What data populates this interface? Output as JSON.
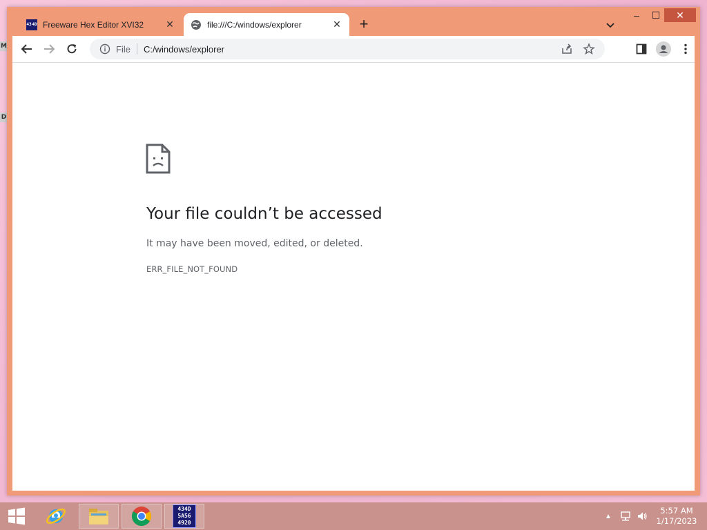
{
  "desktop": {
    "edge_glyphs": [
      "M",
      "D"
    ]
  },
  "browser": {
    "tabs": [
      {
        "title": "Freeware Hex Editor XVI32",
        "active": false,
        "favicon": "hex-editor-icon",
        "favicon_text": "434D"
      },
      {
        "title": "file:///C:/windows/explorer",
        "active": true,
        "favicon": "globe-icon"
      }
    ],
    "new_tab_glyph": "+",
    "window_controls": {
      "minimize": "–",
      "maximize": "☐",
      "close": "✕"
    },
    "toolbar": {
      "back": "back-arrow-icon",
      "forward": "forward-arrow-icon",
      "reload": "reload-icon",
      "omnibox_scheme": "File",
      "omnibox_url": "C:/windows/explorer",
      "share": "share-icon",
      "bookmark": "star-icon",
      "side_panel": "side-panel-icon",
      "profile": "profile-icon",
      "menu": "kebab-menu-icon"
    },
    "page": {
      "heading": "Your file couldn’t be accessed",
      "subtext": "It may have been moved, edited, or deleted.",
      "error_code": "ERR_FILE_NOT_FOUND"
    }
  },
  "taskbar": {
    "items": [
      "windows-start-icon",
      "internet-explorer-icon",
      "file-explorer-icon",
      "chrome-icon",
      "hex-editor-icon"
    ],
    "hex_icon_text": [
      "434D",
      "5A56",
      "4920"
    ],
    "clock_time": "5:57 AM",
    "clock_date": "1/17/2023"
  },
  "colors": {
    "window_frame": "#f09a78",
    "taskbar": "#c9928d",
    "close_button": "#c6553f"
  }
}
